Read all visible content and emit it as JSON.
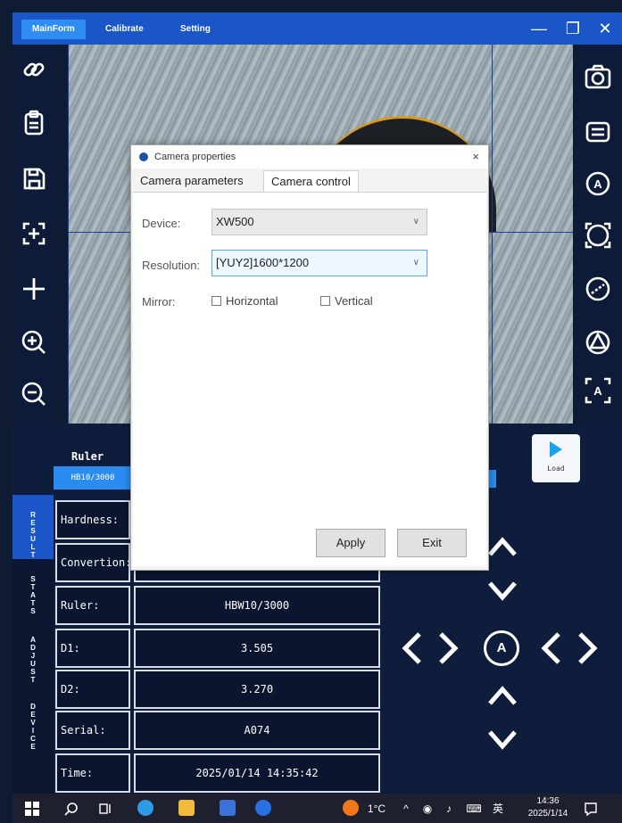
{
  "titlebar": {
    "tabs": [
      {
        "label": "MainForm",
        "active": true
      },
      {
        "label": "Calibrate",
        "active": false
      },
      {
        "label": "Setting",
        "active": false
      }
    ],
    "minimize": "—",
    "maximize": "❐",
    "close": "✕"
  },
  "left_tools": [
    "link-icon",
    "clipboard-icon",
    "save-icon",
    "focus-plus-icon",
    "add-icon",
    "zoom-in-icon",
    "zoom-out-icon"
  ],
  "right_tools": [
    "camera-icon",
    "switch-icon",
    "auto-a-icon",
    "brackets-icon",
    "circle-dashed-icon",
    "auto-triangle-icon",
    "auto-box-icon"
  ],
  "bottom": {
    "ruler_label": "Ruler",
    "ruler_value": "HB10/3000",
    "load_label": "Load",
    "vertical_tabs": [
      "RESULT",
      "STATS",
      "ADJUST",
      "DEVICE"
    ],
    "rows": [
      {
        "label": "Hardness:",
        "value": ""
      },
      {
        "label": "Convertion:",
        "value": ""
      },
      {
        "label": "Ruler:",
        "value": "HBW10/3000"
      },
      {
        "label": "D1:",
        "value": "3.505"
      },
      {
        "label": "D2:",
        "value": "3.270"
      },
      {
        "label": "Serial:",
        "value": "A074"
      },
      {
        "label": "Time:",
        "value": "2025/01/14 14:35:42"
      }
    ],
    "auto_button": "A"
  },
  "dialog": {
    "title": "Camera properties",
    "close": "×",
    "tabs": [
      {
        "label": "Camera parameters",
        "active": false
      },
      {
        "label": "Camera control",
        "active": true
      }
    ],
    "device_label": "Device:",
    "device_value": "XW500",
    "resolution_label": "Resolution:",
    "resolution_value": "[YUY2]1600*1200",
    "mirror_label": "Mirror:",
    "mirror_horizontal": "Horizontal",
    "mirror_vertical": "Vertical",
    "apply": "Apply",
    "exit": "Exit"
  },
  "taskbar": {
    "weather": "1°C",
    "ime": "英",
    "time": "14:36",
    "date": "2025/1/14"
  }
}
